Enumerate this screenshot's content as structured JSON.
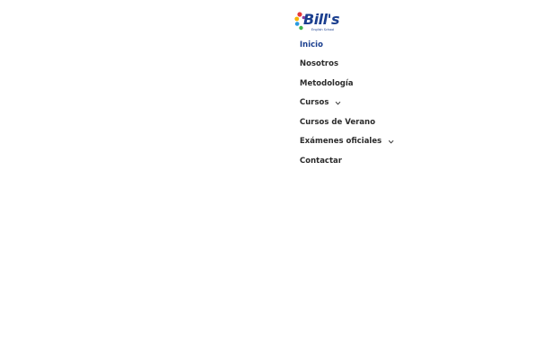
{
  "logo": {
    "name": "Bill's",
    "subtitle": "English School",
    "colors": {
      "text": "#1b3f8f",
      "dot_red": "#e63a3a",
      "dot_yellow": "#f5b400",
      "dot_green": "#3cb44a",
      "dot_blue": "#2a9be0",
      "dot_purple": "#8a3fa0"
    }
  },
  "nav": {
    "active_color": "#1b3f8f",
    "text_color": "#2b2b2b",
    "items": [
      {
        "label": "Inicio",
        "active": true,
        "has_submenu": false
      },
      {
        "label": "Nosotros",
        "active": false,
        "has_submenu": false
      },
      {
        "label": "Metodología",
        "active": false,
        "has_submenu": false
      },
      {
        "label": "Cursos",
        "active": false,
        "has_submenu": true,
        "icon": "chevron-down-icon"
      },
      {
        "label": "Cursos de Verano",
        "active": false,
        "has_submenu": false
      },
      {
        "label": "Exámenes oficiales",
        "active": false,
        "has_submenu": true,
        "icon": "chevron-down-icon"
      },
      {
        "label": "Contactar",
        "active": false,
        "has_submenu": false
      }
    ]
  }
}
